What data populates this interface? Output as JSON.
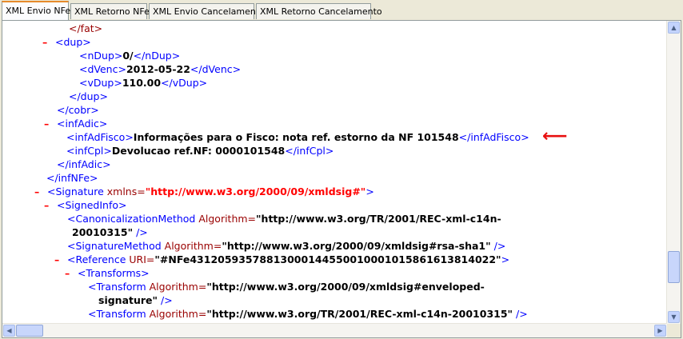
{
  "tabs": [
    {
      "label": "XML Envio NFe",
      "active": true
    },
    {
      "label": "XML Retorno NFe",
      "active": false
    },
    {
      "label": "XML Envio Cancelamento",
      "active": false
    },
    {
      "label": "XML Retorno Cancelamento",
      "active": false
    }
  ],
  "xml": {
    "fat_close": "</fat>",
    "dup_open": "<dup>",
    "nDup": {
      "open": "<nDup>",
      "value": "0/",
      "close": "</nDup>"
    },
    "dVenc": {
      "open": "<dVenc>",
      "value": "2012-05-22",
      "close": "</dVenc>"
    },
    "vDup": {
      "open": "<vDup>",
      "value": "110.00",
      "close": "</vDup>"
    },
    "dup_close": "</dup>",
    "cobr_close": "</cobr>",
    "infAdic_open": "<infAdic>",
    "infAdFisco": {
      "open": "<infAdFisco>",
      "value": "Informações para o Fisco: nota ref. estorno da NF 101548",
      "close": "</infAdFisco>"
    },
    "infCpl": {
      "open": "<infCpl>",
      "value": "Devolucao ref.NF: 0000101548",
      "close": "</infCpl>"
    },
    "infAdic_close": "</infAdic>",
    "infNFe_close": "</infNFe>",
    "signature": {
      "open": "<Signature",
      "attr": " xmlns=",
      "value": "\"http://www.w3.org/2000/09/xmldsig#\"",
      "end": ">"
    },
    "signedInfo_open": "<SignedInfo>",
    "canon": {
      "open": "<CanonicalizationMethod",
      "attr": " Algorithm=",
      "value1": "\"http://www.w3.org/TR/2001/REC-xml-c14n-",
      "value2": "20010315\"",
      "end": " />"
    },
    "sigMethod": {
      "open": "<SignatureMethod",
      "attr": " Algorithm=",
      "value": "\"http://www.w3.org/2000/09/xmldsig#rsa-sha1\"",
      "end": " />"
    },
    "reference": {
      "open": "<Reference",
      "attr": " URI=",
      "value": "\"#NFe43120593578813000144550010001015861613814022\"",
      "end": ">"
    },
    "transforms_open": "<Transforms>",
    "transform1": {
      "open": "<Transform",
      "attr": " Algorithm=",
      "value1": "\"http://www.w3.org/2000/09/xmldsig#enveloped-",
      "value2": "signature\"",
      "end": " />"
    },
    "transform2": {
      "open": "<Transform",
      "attr": " Algorithm=",
      "value": "\"http://www.w3.org/TR/2001/REC-xml-c14n-20010315\"",
      "end": " />"
    },
    "collapse_symbol": "–",
    "arrow_symbol": "⟵"
  },
  "scrollbar": {
    "up": "▲",
    "down": "▼",
    "left": "◀",
    "right": "▶"
  },
  "colors": {
    "arrow": "#e81010",
    "tag": "#990000",
    "bracket": "#0000ff",
    "collapse": "#ff0000"
  }
}
